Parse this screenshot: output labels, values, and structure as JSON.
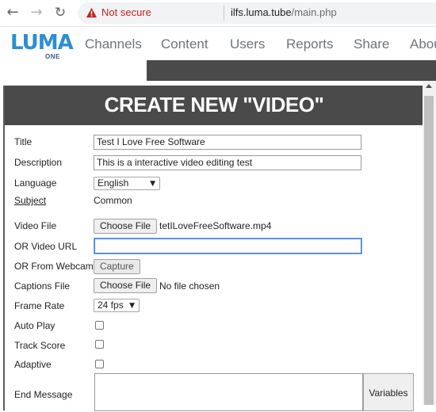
{
  "browser": {
    "security_label": "Not secure",
    "url_host": "ilfs.luma.tube",
    "url_path": "/main.php"
  },
  "header": {
    "logo_text": "LUMA",
    "logo_subtext": "ONE",
    "nav": [
      "Channels",
      "Content",
      "Users",
      "Reports",
      "Share",
      "About"
    ]
  },
  "form": {
    "title": "CREATE NEW \"VIDEO\"",
    "fields": {
      "title_label": "Title",
      "title_value": "Test I Love Free Software",
      "description_label": "Description",
      "description_value": "This is a interactive video editing test",
      "language_label": "Language",
      "language_value": "English",
      "subject_label": "Subject",
      "subject_value": "Common",
      "video_file_label": "Video File",
      "video_file_button": "Choose File",
      "video_file_name": "tetILoveFreeSoftware.mp4",
      "video_url_label": "OR Video URL",
      "video_url_value": "",
      "webcam_label": "OR From Webcam",
      "webcam_button": "Capture",
      "captions_label": "Captions File",
      "captions_button": "Choose File",
      "captions_status": "No file chosen",
      "frame_rate_label": "Frame Rate",
      "frame_rate_value": "24 fps",
      "auto_play_label": "Auto Play",
      "track_score_label": "Track Score",
      "adaptive_label": "Adaptive",
      "end_message_label": "End Message",
      "variables_button": "Variables"
    },
    "checkboxes": {
      "auto_play": false,
      "track_score": false,
      "adaptive": false
    }
  },
  "colors": {
    "title_bar": "#4a4a4a",
    "logo_blue": "#2a8fd4",
    "nav_text": "#6c757d",
    "warning_red": "#c5221f",
    "focus_blue": "#3b78e7"
  }
}
